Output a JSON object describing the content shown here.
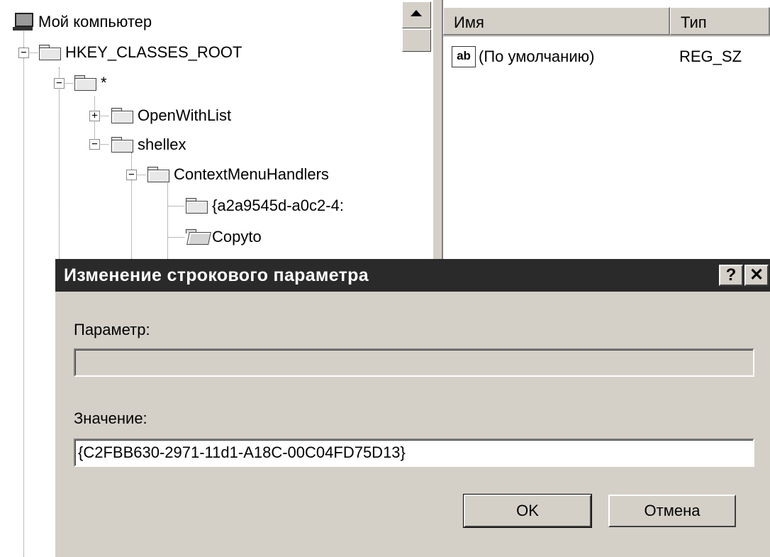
{
  "tree": {
    "root_label": "Мой компьютер",
    "hkcr_label": "HKEY_CLASSES_ROOT",
    "star_label": "*",
    "openwithlist_label": "OpenWithList",
    "shellex_label": "shellex",
    "contextmenu_label": "ContextMenuHandlers",
    "guid_label": "{a2a9545d-a0c2-4:",
    "copyto_label": "Copyto",
    "expand_glyph": "+",
    "collapse_glyph": "−"
  },
  "list": {
    "columns": [
      {
        "label": "Имя"
      },
      {
        "label": "Тип"
      }
    ],
    "rows": [
      {
        "icon": "string-value-icon",
        "icon_text": "ab",
        "name": "(По умолчанию)",
        "type": "REG_SZ"
      }
    ]
  },
  "dialog": {
    "title": "Изменение строкового параметра",
    "help_glyph": "?",
    "close_glyph": "✕",
    "param_label": "Параметр:",
    "param_value": "",
    "value_label": "Значение:",
    "value_value": "{C2FBB630-2971-11d1-A18C-00C04FD75D13}",
    "ok_label": "OK",
    "cancel_label": "Отмена"
  },
  "colors": {
    "title_bar": "#2a2a2a",
    "face": "#d4d0c8"
  }
}
